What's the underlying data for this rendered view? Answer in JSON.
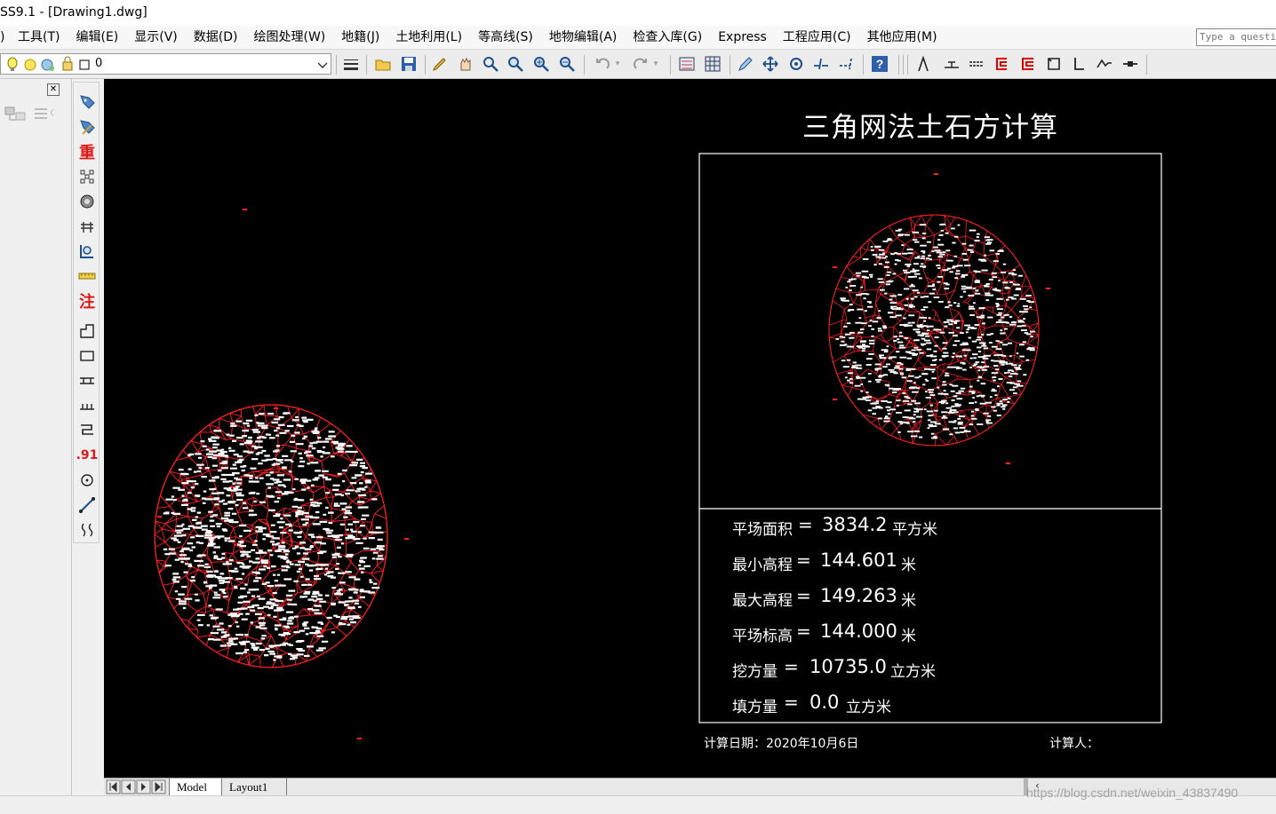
{
  "window": {
    "title": "SS9.1 - [Drawing1.dwg]"
  },
  "menu": {
    "items": [
      "工具(T)",
      "编辑(E)",
      "显示(V)",
      "数据(D)",
      "绘图处理(W)",
      "地籍(J)",
      "土地利用(L)",
      "等高线(S)",
      "地物编辑(A)",
      "检查入库(G)",
      "Express",
      "工程应用(C)",
      "其他应用(M)"
    ],
    "help_placeholder": "Type a question"
  },
  "toolbar": {
    "layer_value": "0"
  },
  "left_toolbar": {
    "labels": [
      "重",
      "注",
      ".91"
    ]
  },
  "drawing": {
    "title": "三角网法土石方计算",
    "results": [
      {
        "label": "平场面积",
        "eq": "=",
        "value": "3834.2",
        "unit": "平方米"
      },
      {
        "label": "最小高程",
        "eq": "=",
        "value": "144.601",
        "unit": "米"
      },
      {
        "label": "最大高程",
        "eq": "=",
        "value": "149.263",
        "unit": "米"
      },
      {
        "label": "平场标高",
        "eq": "=",
        "value": "144.000",
        "unit": "米"
      },
      {
        "label": "挖方量",
        "eq": "=",
        "value": "10735.0",
        "unit": "立方米"
      },
      {
        "label": "填方量",
        "eq": "=",
        "value": "0.0",
        "unit": "立方米"
      }
    ],
    "date_label": "计算日期：",
    "date_value": "2020年10月6日",
    "person_label": "计算人："
  },
  "tabs": {
    "model": "Model",
    "layout1": "Layout1"
  },
  "watermark": "https://blog.csdn.net/weixin_43837490",
  "colors": {
    "mesh": "#ff2020",
    "labels": "#ffffff",
    "canvas": "#000000"
  }
}
